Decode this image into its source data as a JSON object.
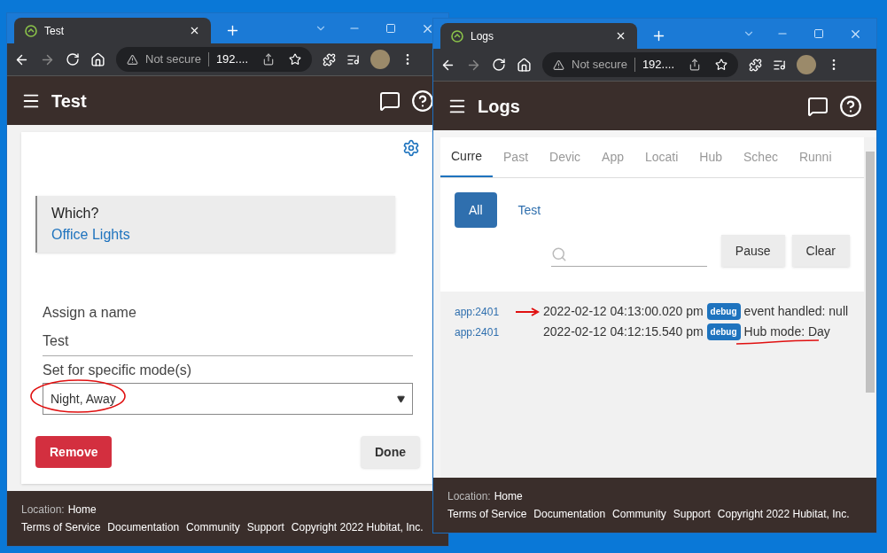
{
  "left_window": {
    "tab_title": "Test",
    "security": "Not secure",
    "url": "192....",
    "app_title": "Test",
    "device_card": {
      "label": "Which?",
      "value": "Office Lights"
    },
    "name_field": {
      "label": "Assign a name",
      "value": "Test"
    },
    "mode_field": {
      "label": "Set for specific mode(s)",
      "value": "Night, Away"
    },
    "buttons": [
      {
        "label": "Remove",
        "kind": "danger"
      },
      {
        "label": "Done",
        "kind": "default"
      }
    ],
    "footer": {
      "location_label": "Location:",
      "location": "Home",
      "links": [
        "Terms of Service",
        "Documentation",
        "Community",
        "Support"
      ],
      "copyright": "Copyright 2022 Hubitat, Inc."
    }
  },
  "right_window": {
    "tab_title": "Logs",
    "security": "Not secure",
    "url": "192....",
    "app_title": "Logs",
    "tabs": [
      {
        "label": "Curre",
        "selected": true
      },
      {
        "label": "Past",
        "selected": false
      },
      {
        "label": "Devic",
        "selected": false
      },
      {
        "label": "App",
        "selected": false
      },
      {
        "label": "Locati",
        "selected": false
      },
      {
        "label": "Hub",
        "selected": false
      },
      {
        "label": "Schec",
        "selected": false
      },
      {
        "label": "Runni",
        "selected": false
      }
    ],
    "filters": [
      {
        "label": "All",
        "selected": true
      },
      {
        "label": "Test",
        "selected": false
      }
    ],
    "actions": [
      "Pause",
      "Clear"
    ],
    "log_rows": [
      {
        "source": "app:2401",
        "time": "2022-02-12 04:13:00.020 pm",
        "level": "debug",
        "message": "event handled: null"
      },
      {
        "source": "app:2401",
        "time": "2022-02-12 04:12:15.540 pm",
        "level": "debug",
        "message": "Hub mode: Day"
      }
    ],
    "footer": {
      "location_label": "Location:",
      "location": "Home",
      "links": [
        "Terms of Service",
        "Documentation",
        "Community",
        "Support"
      ],
      "copyright": "Copyright 2022 Hubitat, Inc."
    }
  }
}
